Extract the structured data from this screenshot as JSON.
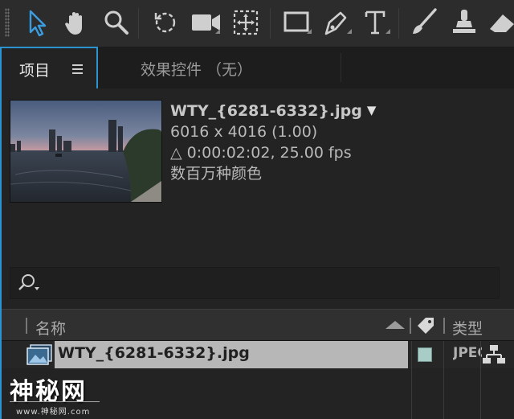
{
  "toolbar": {
    "tools": [
      "selection-tool-icon",
      "hand-tool-icon",
      "zoom-tool-icon",
      "rotate-tool-icon",
      "camera-tool-icon",
      "pan-behind-tool-icon",
      "rectangle-tool-icon",
      "pen-tool-icon",
      "type-tool-icon",
      "brush-tool-icon",
      "clone-stamp-tool-icon",
      "eraser-tool-icon"
    ],
    "accent": "#2a93d0"
  },
  "tabs": {
    "project_label": "项目",
    "effects_label": "效果控件 （无）"
  },
  "preview": {
    "file_name": "WTY_{6281-6332}.jpg",
    "dimensions": "6016 x 4016 (1.00)",
    "duration": "△ 0:00:02:02, 25.00 fps",
    "colors": "数百万种颜色"
  },
  "columns": {
    "name": "名称",
    "type": "类型"
  },
  "items": [
    {
      "name": "WTY_{6281-6332}.jpg",
      "type": "JPEG",
      "label_color": "#a8ccc6"
    }
  ],
  "watermark": {
    "title": "神秘网",
    "subtitle": "www.神秘网.com"
  }
}
